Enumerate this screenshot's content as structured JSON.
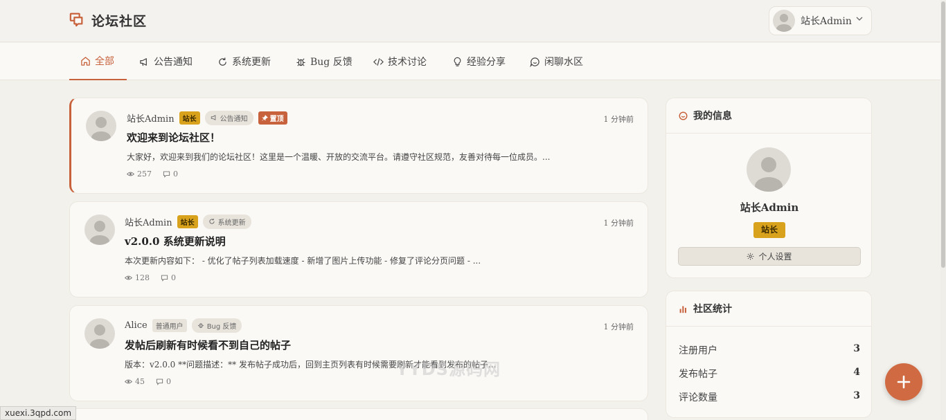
{
  "site": {
    "title": "论坛社区"
  },
  "user_menu": {
    "name": "站长Admin"
  },
  "nav": {
    "tabs": [
      {
        "label": "全部",
        "icon": "home-icon",
        "active": true
      },
      {
        "label": "公告通知",
        "icon": "megaphone-icon"
      },
      {
        "label": "系统更新",
        "icon": "refresh-icon"
      },
      {
        "label": "Bug 反馈",
        "icon": "bug-icon"
      },
      {
        "label": "技术讨论",
        "icon": "code-icon"
      },
      {
        "label": "经验分享",
        "icon": "lightbulb-icon"
      },
      {
        "label": "闲聊水区",
        "icon": "chat-icon"
      }
    ]
  },
  "posts": [
    {
      "author": "站长Admin",
      "role": "站长",
      "category": "公告通知",
      "pinned_label": "置顶",
      "time": "1 分钟前",
      "title": "欢迎来到论坛社区！",
      "excerpt": "大家好，欢迎来到我们的论坛社区！这里是一个温暖、开放的交流平台。请遵守社区规范，友善对待每一位成员。...",
      "views": "257",
      "comments": "0"
    },
    {
      "author": "站长Admin",
      "role": "站长",
      "category": "系统更新",
      "time": "1 分钟前",
      "title": "v2.0.0 系统更新说明",
      "excerpt": "本次更新内容如下： - 优化了帖子列表加载速度 - 新增了图片上传功能 - 修复了评论分页问题 - ...",
      "views": "128",
      "comments": "0"
    },
    {
      "author": "Alice",
      "role": "普通用户",
      "category": "Bug 反馈",
      "time": "1 分钟前",
      "title": "发帖后刷新有时候看不到自己的帖子",
      "excerpt": "版本：v2.0.0 **问题描述：** 发布帖子成功后，回到主页列表有时候需要刷新才能看到发布的帖子...",
      "views": "45",
      "comments": "0"
    }
  ],
  "profile_card": {
    "title": "我的信息",
    "name": "站长Admin",
    "role": "站长",
    "settings_label": "个人设置"
  },
  "stats_card": {
    "title": "社区统计",
    "rows": [
      {
        "label": "注册用户",
        "value": "3"
      },
      {
        "label": "发布帖子",
        "value": "4"
      },
      {
        "label": "评论数量",
        "value": "3"
      }
    ]
  },
  "status_url": "xuexi.3qpd.com",
  "watermark": "YYDS源码网",
  "colors": {
    "accent": "#c8623c",
    "admin_badge": "#d9a21d",
    "background": "#f3f1ec"
  }
}
